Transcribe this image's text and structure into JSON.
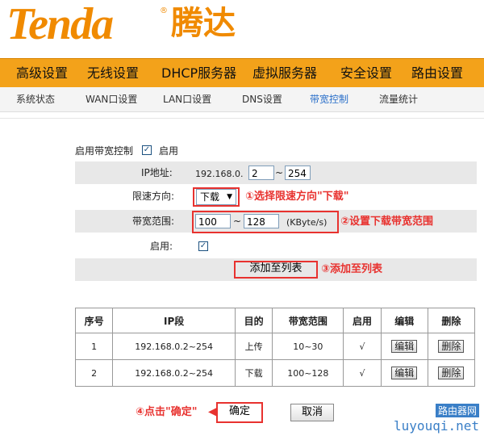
{
  "brand": {
    "logo_text": "Tenda",
    "logo_cn": "腾达",
    "reg": "®"
  },
  "nav": {
    "items": [
      "高级设置",
      "无线设置",
      "DHCP服务器",
      "虚拟服务器",
      "安全设置",
      "路由设置"
    ]
  },
  "subnav": {
    "items": [
      "系统状态",
      "WAN口设置",
      "LAN口设置",
      "DNS设置",
      "带宽控制",
      "流量统计"
    ],
    "active": "带宽控制"
  },
  "form": {
    "enable_bw_label": "启用带宽控制",
    "enable_label": "启用",
    "ip_label": "IP地址:",
    "ip_prefix": "192.168.0.",
    "ip_start": "2",
    "ip_sep": "~",
    "ip_end": "254",
    "direction_label": "限速方向:",
    "direction_value": "下载",
    "range_label": "带宽范围:",
    "range_min": "100",
    "range_sep": "~",
    "range_max": "128",
    "range_unit": "(KByte/s)",
    "enable_row_label": "启用:",
    "add_button": "添加至列表"
  },
  "annotations": {
    "step1": "①选择限速方向\"下载\"",
    "step2": "②设置下载带宽范围",
    "step3": "③添加至列表",
    "step4": "④点击\"确定\""
  },
  "table": {
    "headers": [
      "序号",
      "IP段",
      "目的",
      "带宽范围",
      "启用",
      "编辑",
      "删除"
    ],
    "rows": [
      {
        "no": "1",
        "ip": "192.168.0.2~254",
        "dir": "上传",
        "range": "10~30",
        "enabled": "√",
        "edit": "编辑",
        "del": "删除"
      },
      {
        "no": "2",
        "ip": "192.168.0.2~254",
        "dir": "下载",
        "range": "100~128",
        "enabled": "√",
        "edit": "编辑",
        "del": "删除"
      }
    ]
  },
  "actions": {
    "ok": "确定",
    "cancel": "取消"
  },
  "watermark": {
    "line1": "路由器网",
    "line2": "luyouqi.net"
  },
  "colors": {
    "brand_orange": "#f08a00",
    "nav_bg": "#f3a21a",
    "annotation_red": "#e8322f",
    "active_blue": "#2a6fc9"
  }
}
